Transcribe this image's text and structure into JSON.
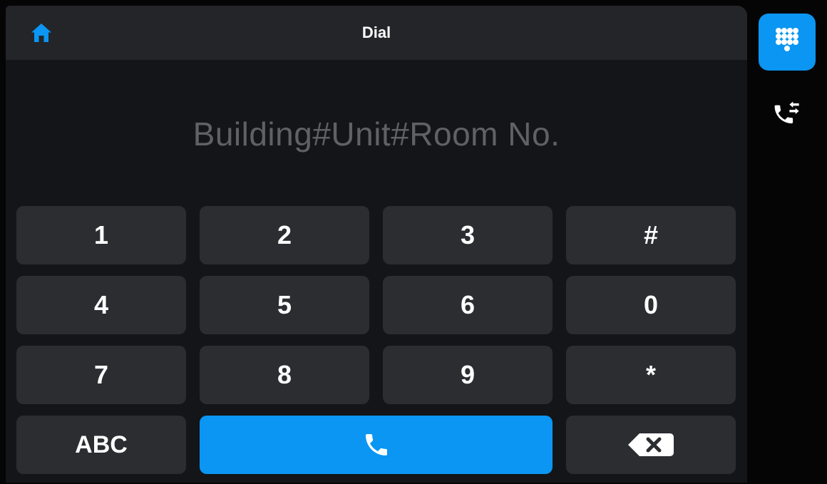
{
  "header": {
    "title": "Dial",
    "home_icon": "home-icon"
  },
  "dial_input": {
    "placeholder": "Building#Unit#Room No.",
    "value": ""
  },
  "keypad": {
    "keys": [
      "1",
      "2",
      "3",
      "#",
      "4",
      "5",
      "6",
      "0",
      "7",
      "8",
      "9",
      "*"
    ],
    "abc_label": "ABC",
    "call_icon": "phone-icon",
    "backspace_icon": "backspace-icon"
  },
  "sidebar": {
    "items": [
      {
        "name": "dialpad",
        "icon": "dialpad-icon",
        "active": true
      },
      {
        "name": "call-history",
        "icon": "call-log-icon",
        "active": false
      }
    ]
  },
  "colors": {
    "accent": "#0a96f2",
    "panel": "#242529",
    "key": "#2c2d31",
    "background": "#141518",
    "placeholder": "#5f6166"
  }
}
